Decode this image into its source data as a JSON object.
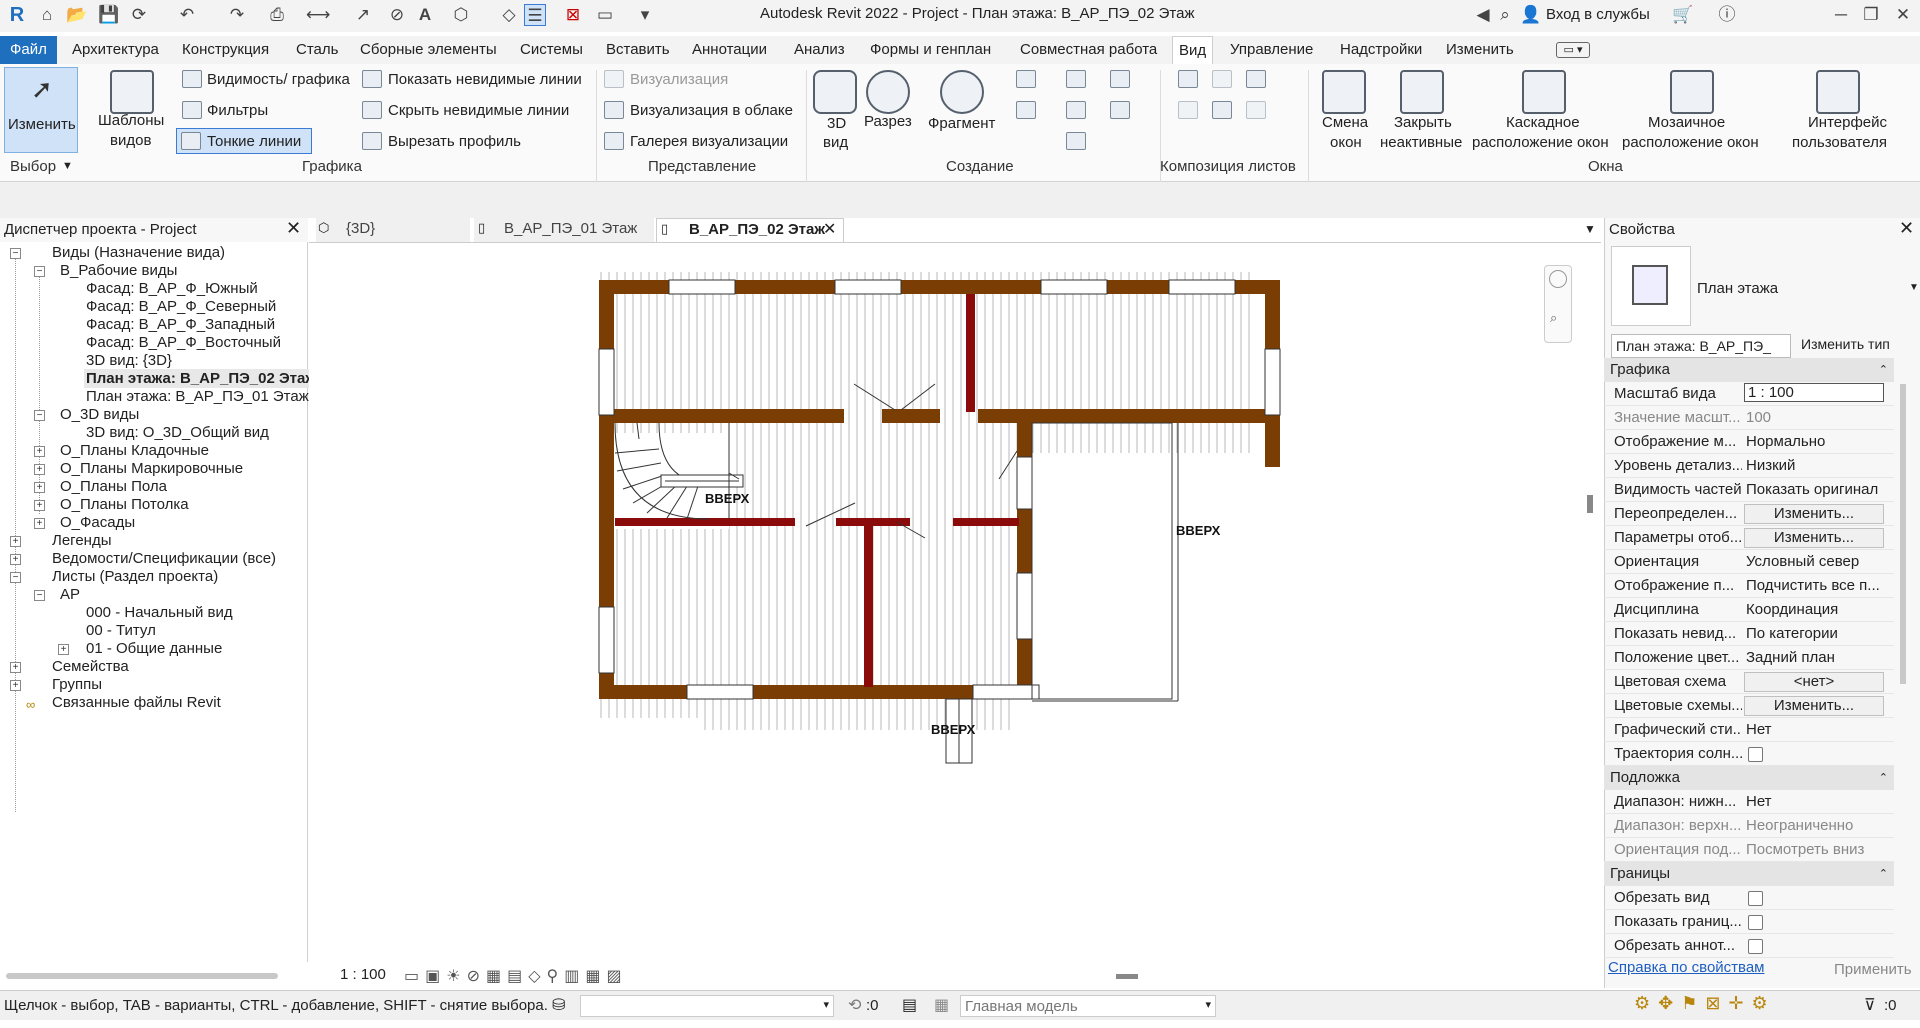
{
  "app": {
    "title": "Autodesk Revit 2022 - Project - План этажа: В_АР_ПЭ_02 Этаж",
    "sign_in": "Вход в службы"
  },
  "menu": [
    "Файл",
    "Архитектура",
    "Конструкция",
    "Сталь",
    "Сборные элементы",
    "Системы",
    "Вставить",
    "Аннотации",
    "Анализ",
    "Формы и генплан",
    "Совместная работа",
    "Вид",
    "Управление",
    "Надстройки",
    "Изменить"
  ],
  "ribbon": {
    "modify": "Изменить",
    "templates_1": "Шаблоны",
    "templates_2": "видов",
    "visibility": "Видимость/ графика",
    "filters": "Фильтры",
    "thin_lines": "Тонкие линии",
    "show_hidden": "Показать невидимые линии",
    "hide_hidden": "Скрыть невидимые линии",
    "cut_profile": "Вырезать профиль",
    "render": "Визуализация",
    "render_cloud": "Визуализация  в облаке",
    "render_gallery": "Галерея  визуализации",
    "view3d_1": "3D",
    "view3d_2": "вид",
    "section": "Разрез",
    "callout": "Фрагмент",
    "switch_1": "Смена",
    "switch_2": "окон",
    "close_1": "Закрыть",
    "close_2": "неактивные",
    "cascade_1": "Каскадное",
    "cascade_2": "расположение окон",
    "tile_1": "Мозаичное",
    "tile_2": "расположение окон",
    "ui_1": "Интерфейс",
    "ui_2": "пользователя",
    "panels": {
      "select": "Выбор",
      "graphics": "Графика",
      "presentation": "Представление",
      "create": "Создание",
      "sheet": "Композиция листов",
      "windows": "Окна"
    }
  },
  "browser": {
    "title": "Диспетчер проекта - Project",
    "items": [
      "Виды (Назначение вида)",
      "В_Рабочие виды",
      "Фасад: В_АР_Ф_Южный",
      "Фасад: В_АР_Ф_Северный",
      "Фасад: В_АР_Ф_Западный",
      "Фасад: В_АР_Ф_Восточный",
      "3D вид: {3D}",
      "План этажа: В_АР_ПЭ_02 Этаж",
      "План этажа: В_АР_ПЭ_01 Этаж",
      "О_3D виды",
      "3D вид: О_3D_Общий вид",
      "О_Планы Кладочные",
      "О_Планы Маркировочные",
      "О_Планы Пола",
      "О_Планы Потолка",
      "О_Фасады",
      "Легенды",
      "Ведомости/Спецификации (все)",
      "Листы (Раздел проекта)",
      "АР",
      "000 - Начальный вид",
      "00 - Титул",
      "01 - Общие данные",
      "Семейства",
      "Группы",
      "Связанные файлы Revit"
    ]
  },
  "view_tabs": [
    "{3D}",
    "В_АР_ПЭ_01 Этаж",
    "В_АР_ПЭ_02 Этаж"
  ],
  "plan": {
    "up_label": "ВВЕРХ"
  },
  "view_bar": {
    "scale": "1 : 100"
  },
  "properties": {
    "title": "Свойства",
    "type_name": "План этажа",
    "selector": "План этажа: В_АР_ПЭ_",
    "edit_type": "Изменить тип",
    "sections": {
      "graphics": "Графика",
      "underlay": "Подложка",
      "extents": "Границы"
    },
    "rows": [
      {
        "label": "Масштаб вида",
        "value": "1 : 100"
      },
      {
        "label": "Значение масшт...",
        "value": "100"
      },
      {
        "label": "Отображение м...",
        "value": "Нормально"
      },
      {
        "label": "Уровень детализ...",
        "value": "Низкий"
      },
      {
        "label": "Видимость частей",
        "value": "Показать оригинал"
      },
      {
        "label": "Переопределен...",
        "value": "Изменить..."
      },
      {
        "label": "Параметры отоб...",
        "value": "Изменить..."
      },
      {
        "label": "Ориентация",
        "value": "Условный север"
      },
      {
        "label": "Отображение п...",
        "value": "Подчистить все п..."
      },
      {
        "label": "Дисциплина",
        "value": "Координация"
      },
      {
        "label": "Показать невид...",
        "value": "По категории"
      },
      {
        "label": "Положение цвет...",
        "value": "Задний план"
      },
      {
        "label": "Цветовая схема",
        "value": "<нет>"
      },
      {
        "label": "Цветовые схемы...",
        "value": "Изменить..."
      },
      {
        "label": "Графический сти...",
        "value": "Нет"
      },
      {
        "label": "Траектория солн...",
        "value": ""
      },
      {
        "label": "Диапазон: нижн...",
        "value": "Нет"
      },
      {
        "label": "Диапазон: верхн...",
        "value": "Неограниченно"
      },
      {
        "label": "Ориентация под...",
        "value": "Посмотреть вниз"
      },
      {
        "label": "Обрезать вид",
        "value": ""
      },
      {
        "label": "Показать границ...",
        "value": ""
      },
      {
        "label": "Обрезать аннот...",
        "value": ""
      }
    ],
    "help": "Справка по свойствам",
    "apply": "Применить"
  },
  "status": {
    "hint": "Щелчок - выбор, TAB - варианты, CTRL - добавление, SHIFT - снятие выбора.",
    "zero": ":0",
    "model": "Главная модель",
    "filter_count": ":0"
  },
  "colors": {
    "accent": "#1f6fbf",
    "wall": "#7a3e05",
    "partition": "#8b0a0a"
  }
}
